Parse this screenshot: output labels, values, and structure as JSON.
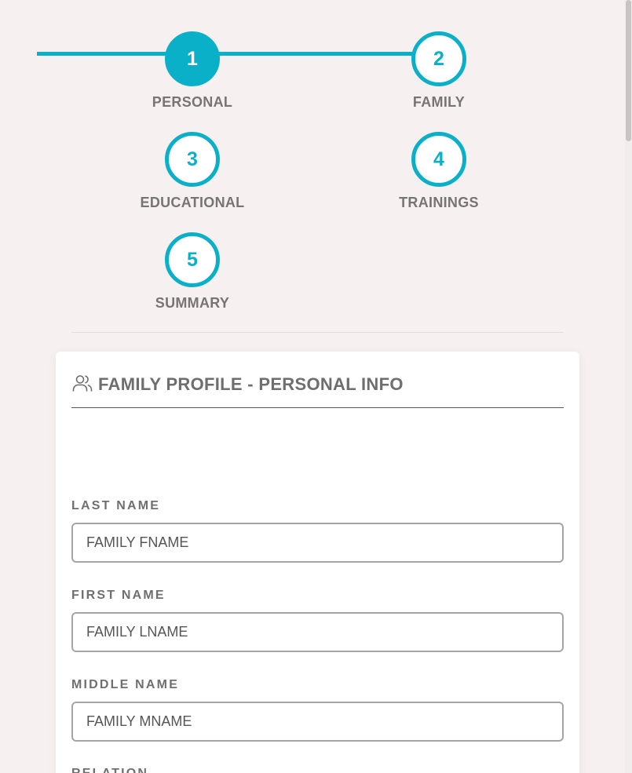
{
  "stepper": {
    "steps": [
      {
        "number": "1",
        "label": "PERSONAL",
        "active": true
      },
      {
        "number": "2",
        "label": "FAMILY",
        "active": false
      },
      {
        "number": "3",
        "label": "EDUCATIONAL",
        "active": false
      },
      {
        "number": "4",
        "label": "TRAININGS",
        "active": false
      },
      {
        "number": "5",
        "label": "SUMMARY",
        "active": false
      }
    ],
    "accent_color": "#09b0c7"
  },
  "card": {
    "icon": "users-icon",
    "title": "FAMILY PROFILE - PERSONAL INFO",
    "fields": [
      {
        "label": "LAST NAME",
        "value": "FAMILY FNAME"
      },
      {
        "label": "FIRST NAME",
        "value": "FAMILY LNAME"
      },
      {
        "label": "MIDDLE NAME",
        "value": "FAMILY MNAME"
      },
      {
        "label": "RELATION"
      }
    ]
  }
}
